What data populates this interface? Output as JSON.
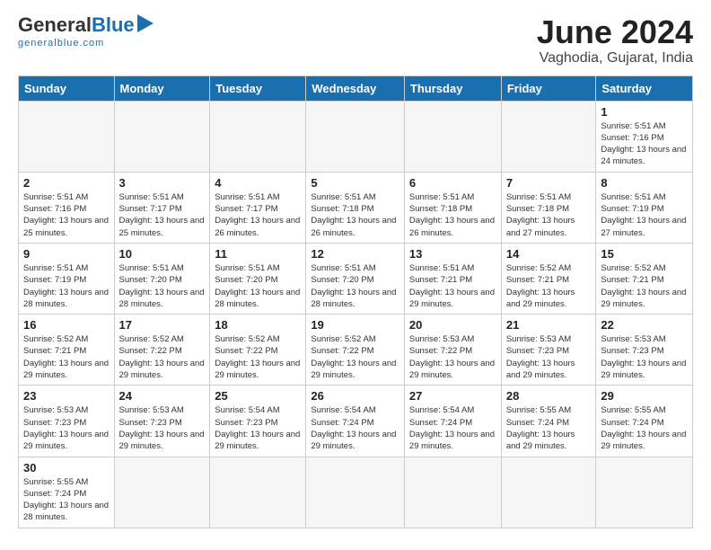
{
  "header": {
    "logo_general": "General",
    "logo_blue": "Blue",
    "logo_sub": "generalblue.com",
    "title": "June 2024",
    "subtitle": "Vaghodia, Gujarat, India"
  },
  "weekdays": [
    "Sunday",
    "Monday",
    "Tuesday",
    "Wednesday",
    "Thursday",
    "Friday",
    "Saturday"
  ],
  "weeks": [
    [
      {
        "day": "",
        "info": ""
      },
      {
        "day": "",
        "info": ""
      },
      {
        "day": "",
        "info": ""
      },
      {
        "day": "",
        "info": ""
      },
      {
        "day": "",
        "info": ""
      },
      {
        "day": "",
        "info": ""
      },
      {
        "day": "1",
        "info": "Sunrise: 5:51 AM\nSunset: 7:16 PM\nDaylight: 13 hours and 24 minutes."
      }
    ],
    [
      {
        "day": "2",
        "info": "Sunrise: 5:51 AM\nSunset: 7:16 PM\nDaylight: 13 hours and 25 minutes."
      },
      {
        "day": "3",
        "info": "Sunrise: 5:51 AM\nSunset: 7:17 PM\nDaylight: 13 hours and 25 minutes."
      },
      {
        "day": "4",
        "info": "Sunrise: 5:51 AM\nSunset: 7:17 PM\nDaylight: 13 hours and 26 minutes."
      },
      {
        "day": "5",
        "info": "Sunrise: 5:51 AM\nSunset: 7:18 PM\nDaylight: 13 hours and 26 minutes."
      },
      {
        "day": "6",
        "info": "Sunrise: 5:51 AM\nSunset: 7:18 PM\nDaylight: 13 hours and 26 minutes."
      },
      {
        "day": "7",
        "info": "Sunrise: 5:51 AM\nSunset: 7:18 PM\nDaylight: 13 hours and 27 minutes."
      },
      {
        "day": "8",
        "info": "Sunrise: 5:51 AM\nSunset: 7:19 PM\nDaylight: 13 hours and 27 minutes."
      }
    ],
    [
      {
        "day": "9",
        "info": "Sunrise: 5:51 AM\nSunset: 7:19 PM\nDaylight: 13 hours and 28 minutes."
      },
      {
        "day": "10",
        "info": "Sunrise: 5:51 AM\nSunset: 7:20 PM\nDaylight: 13 hours and 28 minutes."
      },
      {
        "day": "11",
        "info": "Sunrise: 5:51 AM\nSunset: 7:20 PM\nDaylight: 13 hours and 28 minutes."
      },
      {
        "day": "12",
        "info": "Sunrise: 5:51 AM\nSunset: 7:20 PM\nDaylight: 13 hours and 28 minutes."
      },
      {
        "day": "13",
        "info": "Sunrise: 5:51 AM\nSunset: 7:21 PM\nDaylight: 13 hours and 29 minutes."
      },
      {
        "day": "14",
        "info": "Sunrise: 5:52 AM\nSunset: 7:21 PM\nDaylight: 13 hours and 29 minutes."
      },
      {
        "day": "15",
        "info": "Sunrise: 5:52 AM\nSunset: 7:21 PM\nDaylight: 13 hours and 29 minutes."
      }
    ],
    [
      {
        "day": "16",
        "info": "Sunrise: 5:52 AM\nSunset: 7:21 PM\nDaylight: 13 hours and 29 minutes."
      },
      {
        "day": "17",
        "info": "Sunrise: 5:52 AM\nSunset: 7:22 PM\nDaylight: 13 hours and 29 minutes."
      },
      {
        "day": "18",
        "info": "Sunrise: 5:52 AM\nSunset: 7:22 PM\nDaylight: 13 hours and 29 minutes."
      },
      {
        "day": "19",
        "info": "Sunrise: 5:52 AM\nSunset: 7:22 PM\nDaylight: 13 hours and 29 minutes."
      },
      {
        "day": "20",
        "info": "Sunrise: 5:53 AM\nSunset: 7:22 PM\nDaylight: 13 hours and 29 minutes."
      },
      {
        "day": "21",
        "info": "Sunrise: 5:53 AM\nSunset: 7:23 PM\nDaylight: 13 hours and 29 minutes."
      },
      {
        "day": "22",
        "info": "Sunrise: 5:53 AM\nSunset: 7:23 PM\nDaylight: 13 hours and 29 minutes."
      }
    ],
    [
      {
        "day": "23",
        "info": "Sunrise: 5:53 AM\nSunset: 7:23 PM\nDaylight: 13 hours and 29 minutes."
      },
      {
        "day": "24",
        "info": "Sunrise: 5:53 AM\nSunset: 7:23 PM\nDaylight: 13 hours and 29 minutes."
      },
      {
        "day": "25",
        "info": "Sunrise: 5:54 AM\nSunset: 7:23 PM\nDaylight: 13 hours and 29 minutes."
      },
      {
        "day": "26",
        "info": "Sunrise: 5:54 AM\nSunset: 7:24 PM\nDaylight: 13 hours and 29 minutes."
      },
      {
        "day": "27",
        "info": "Sunrise: 5:54 AM\nSunset: 7:24 PM\nDaylight: 13 hours and 29 minutes."
      },
      {
        "day": "28",
        "info": "Sunrise: 5:55 AM\nSunset: 7:24 PM\nDaylight: 13 hours and 29 minutes."
      },
      {
        "day": "29",
        "info": "Sunrise: 5:55 AM\nSunset: 7:24 PM\nDaylight: 13 hours and 29 minutes."
      }
    ],
    [
      {
        "day": "30",
        "info": "Sunrise: 5:55 AM\nSunset: 7:24 PM\nDaylight: 13 hours and 28 minutes."
      },
      {
        "day": "",
        "info": ""
      },
      {
        "day": "",
        "info": ""
      },
      {
        "day": "",
        "info": ""
      },
      {
        "day": "",
        "info": ""
      },
      {
        "day": "",
        "info": ""
      },
      {
        "day": "",
        "info": ""
      }
    ]
  ]
}
